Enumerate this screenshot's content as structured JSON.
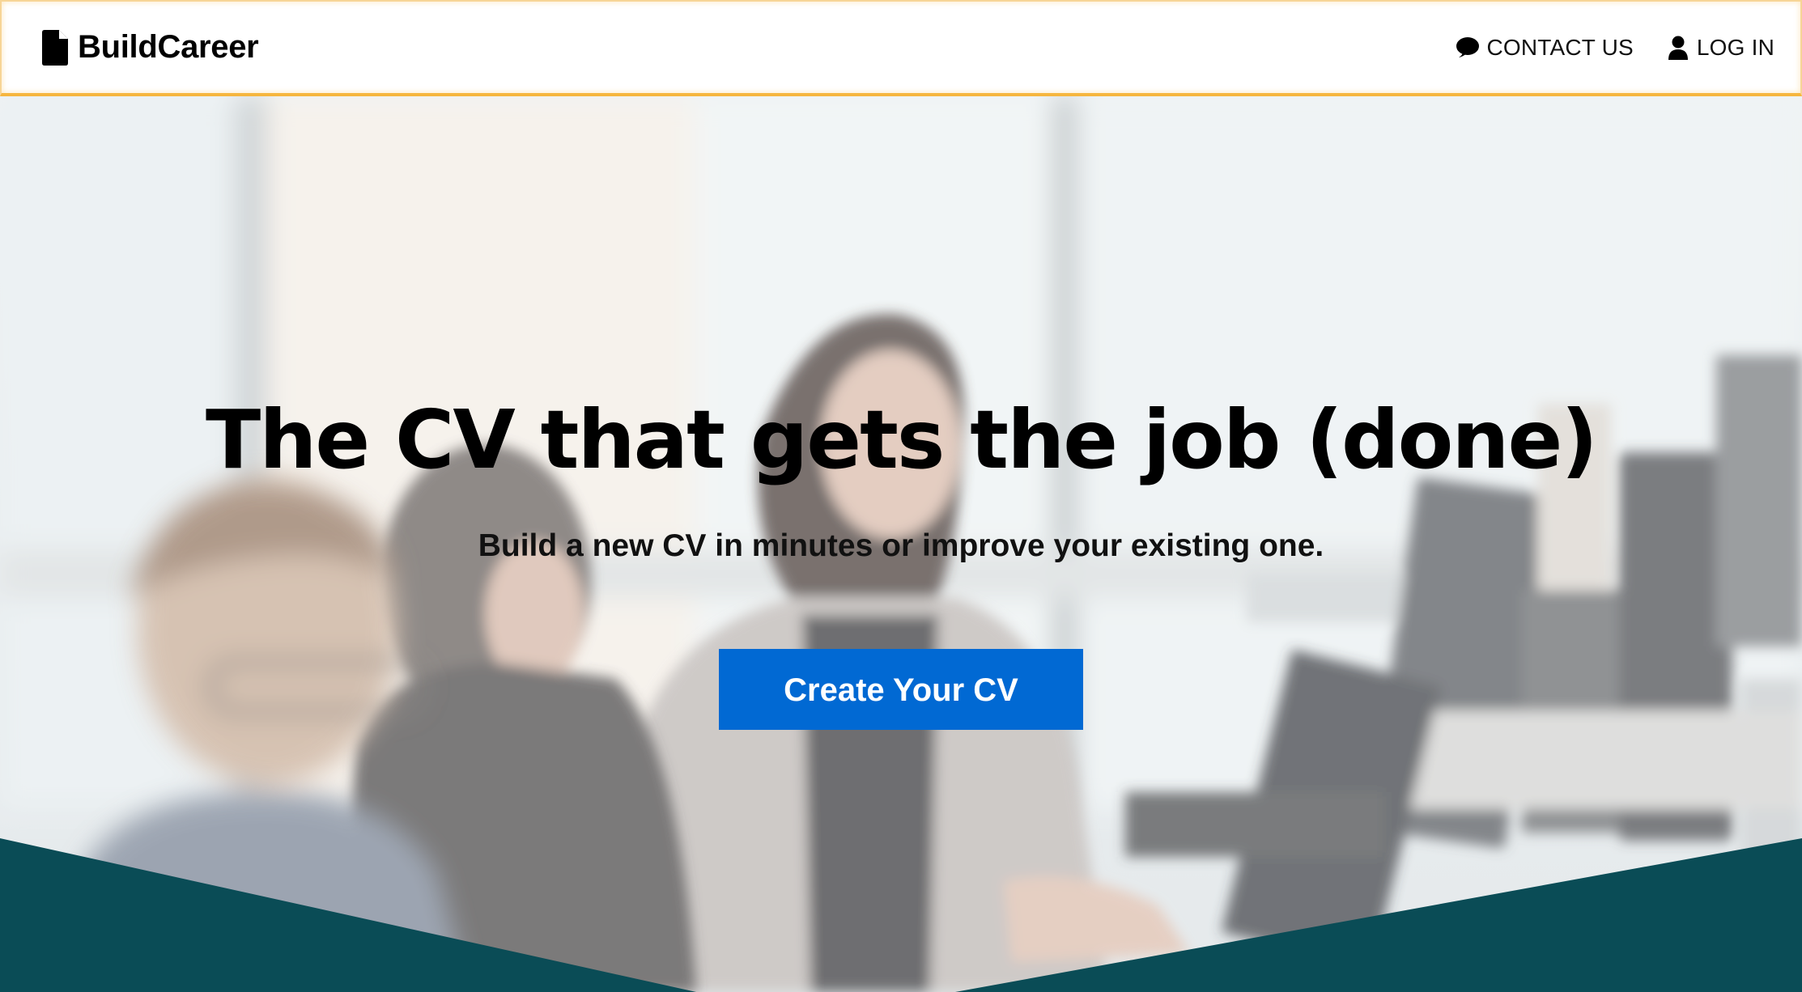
{
  "nav": {
    "brand": "BuildCareer",
    "brand_icon": "document-icon",
    "links": [
      {
        "label": "CONTACT US",
        "icon": "chat-bubble-icon"
      },
      {
        "label": "LOG IN",
        "icon": "user-icon"
      }
    ]
  },
  "hero": {
    "title": "The CV that gets the job (done)",
    "subtitle": "Build a new CV in minutes or improve your existing one.",
    "cta_label": "Create Your CV",
    "background_image": "office-workers-at-computers-photo"
  },
  "colors": {
    "cta": "#0169d3",
    "wave": "#0a4c56",
    "nav_border": "#f6b63f"
  }
}
